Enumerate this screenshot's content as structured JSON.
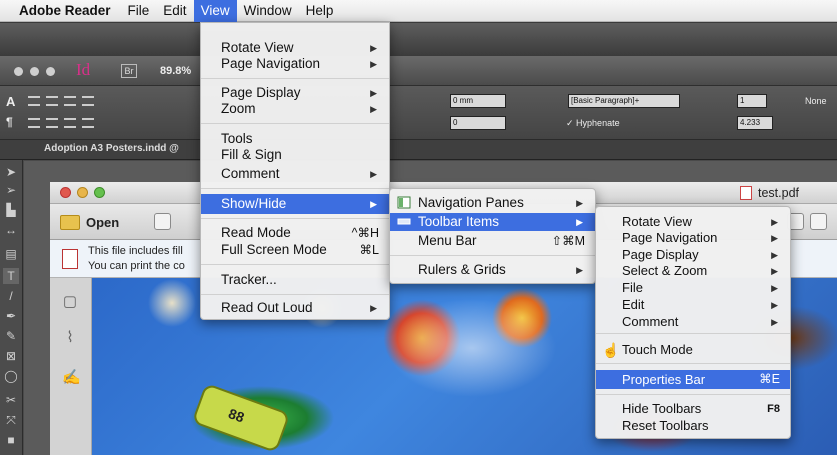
{
  "menubar": {
    "app": "Adobe Reader",
    "items": [
      "File",
      "Edit",
      "View",
      "Window",
      "Help"
    ]
  },
  "indesign": {
    "zoom": "89.8%",
    "doc_tab": "Adoption A3 Posters.indd @",
    "control": {
      "size_a": "0 mm",
      "size_b": "0",
      "paragraph_style": "[Basic Paragraph]+",
      "hyphenate": "Hyphenate",
      "cols": "1",
      "gutter": "4.233",
      "none": "None"
    }
  },
  "reader": {
    "title": "test.pdf",
    "open_label": "Open",
    "info_line1": "This file includes fill",
    "info_line2": "You can print the co"
  },
  "view_menu": {
    "items": [
      {
        "label": "Rotate View",
        "submenu": true
      },
      {
        "label": "Page Navigation",
        "submenu": true
      },
      {
        "label": "Page Display",
        "submenu": true
      },
      {
        "label": "Zoom",
        "submenu": true
      },
      {
        "label": "Tools"
      },
      {
        "label": "Fill & Sign"
      },
      {
        "label": "Comment",
        "submenu": true
      },
      {
        "label": "Show/Hide",
        "submenu": true,
        "highlighted": true
      },
      {
        "label": "Read Mode",
        "shortcut": "^⌘H"
      },
      {
        "label": "Full Screen Mode",
        "shortcut": "⌘L"
      },
      {
        "label": "Tracker..."
      },
      {
        "label": "Read Out Loud",
        "submenu": true
      }
    ]
  },
  "showhide_menu": {
    "items": [
      {
        "label": "Navigation Panes",
        "submenu": true
      },
      {
        "label": "Toolbar Items",
        "submenu": true,
        "highlighted": true
      },
      {
        "label": "Menu Bar",
        "shortcut": "⇧⌘M"
      },
      {
        "label": "Rulers & Grids",
        "submenu": true
      }
    ]
  },
  "toolbar_items_menu": {
    "items": [
      {
        "label": "Rotate View",
        "submenu": true
      },
      {
        "label": "Page Navigation",
        "submenu": true
      },
      {
        "label": "Page Display",
        "submenu": true
      },
      {
        "label": "Select & Zoom",
        "submenu": true
      },
      {
        "label": "File",
        "submenu": true
      },
      {
        "label": "Edit",
        "submenu": true
      },
      {
        "label": "Comment",
        "submenu": true
      },
      {
        "label": "Touch Mode"
      },
      {
        "label": "Properties Bar",
        "shortcut": "⌘E",
        "highlighted": true
      },
      {
        "label": "Hide Toolbars",
        "shortcut": "F8"
      },
      {
        "label": "Reset Toolbars"
      }
    ]
  },
  "colors": {
    "highlight": "#3d6ee0",
    "indesign_pink": "#d8308a"
  }
}
